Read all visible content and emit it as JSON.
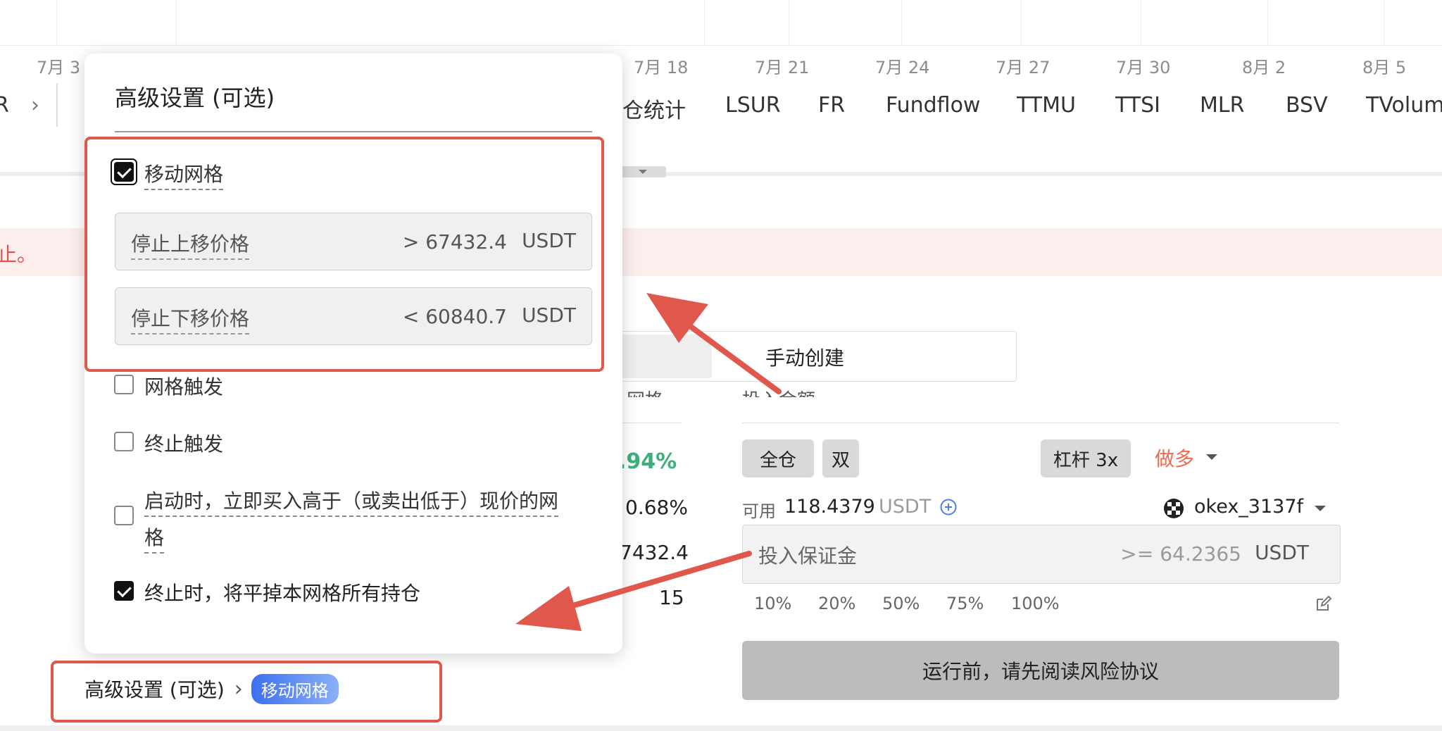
{
  "chart_strip": {
    "dates": [
      "7月 3",
      "7月 18",
      "7月 21",
      "7月 24",
      "7月 27",
      "7月 30",
      "8月 2",
      "8月 5"
    ]
  },
  "indicator_tabs": {
    "left_fragment": "R",
    "nav_chevron": "›",
    "partial_tab": "仓统计",
    "items": [
      "LSUR",
      "FR",
      "Fundflow",
      "TTMU",
      "TTSI",
      "MLR",
      "BSV",
      "TVolume"
    ]
  },
  "alert": {
    "text_fragment": "止。"
  },
  "create_mode": {
    "manual_label": "手动创建"
  },
  "stats": {
    "values": [
      ".94%",
      "0.68%",
      "7432.4",
      "15"
    ],
    "section_fragment": "投入金额",
    "left_fragment": "网格"
  },
  "position": {
    "cross_label": "全仓",
    "dual_label": "双",
    "leverage_label": "杠杆 3x",
    "direction_label": "做多",
    "available_prefix": "可用",
    "available_value": "118.4379",
    "available_unit": "USDT",
    "account_name": "okex_3137f",
    "margin_placeholder": "投入保证金",
    "margin_min": ">= 64.2365",
    "margin_unit": "USDT",
    "percent_options": [
      "10%",
      "20%",
      "50%",
      "75%",
      "100%"
    ],
    "run_button": "运行前，请先阅读风险协议"
  },
  "advanced_popup": {
    "title": "高级设置 (可选)",
    "moving_grid": {
      "label": "移动网格",
      "checked": true
    },
    "stop_up": {
      "label": "停止上移价格",
      "value": "> 67432.4",
      "unit": "USDT"
    },
    "stop_down": {
      "label": "停止下移价格",
      "value": "< 60840.7",
      "unit": "USDT"
    },
    "grid_trigger": {
      "label": "网格触发",
      "checked": false
    },
    "stop_trigger": {
      "label": "终止触发",
      "checked": false
    },
    "buy_on_start": {
      "label_line1": "启动时，立即买入高于（或卖出低于）现价的网",
      "label_line2": "格",
      "checked": false
    },
    "close_on_stop": {
      "label": "终止时，将平掉本网格所有持仓",
      "checked": true
    }
  },
  "advanced_summary": {
    "label": "高级设置 (可选)",
    "chevron": "›",
    "tag": "移动网格"
  },
  "colors": {
    "highlight_red": "#e0584c",
    "positive_green": "#3db07a",
    "direction_orange": "#ef6b4d",
    "tag_blue": "#4c7bf0"
  }
}
